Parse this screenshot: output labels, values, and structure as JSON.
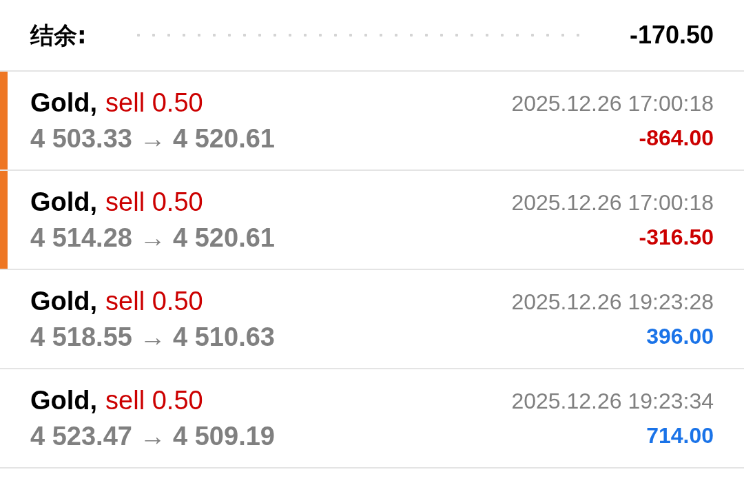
{
  "balance": {
    "label": "结余:",
    "value": "-170.50"
  },
  "deals": [
    {
      "symbol": "Gold,",
      "side": "sell 0.50",
      "prices": "4 503.33 → 4 520.61",
      "time": "2025.12.26 17:00:18",
      "profit": "-864.00",
      "kind": "loss",
      "highlighted": true
    },
    {
      "symbol": "Gold,",
      "side": "sell 0.50",
      "prices": "4 514.28 → 4 520.61",
      "time": "2025.12.26 17:00:18",
      "profit": "-316.50",
      "kind": "loss",
      "highlighted": true
    },
    {
      "symbol": "Gold,",
      "side": "sell 0.50",
      "prices": "4 518.55 → 4 510.63",
      "time": "2025.12.26 19:23:28",
      "profit": "396.00",
      "kind": "profit",
      "highlighted": false
    },
    {
      "symbol": "Gold,",
      "side": "sell 0.50",
      "prices": "4 523.47 → 4 509.19",
      "time": "2025.12.26 19:23:34",
      "profit": "714.00",
      "kind": "profit",
      "highlighted": false
    }
  ]
}
